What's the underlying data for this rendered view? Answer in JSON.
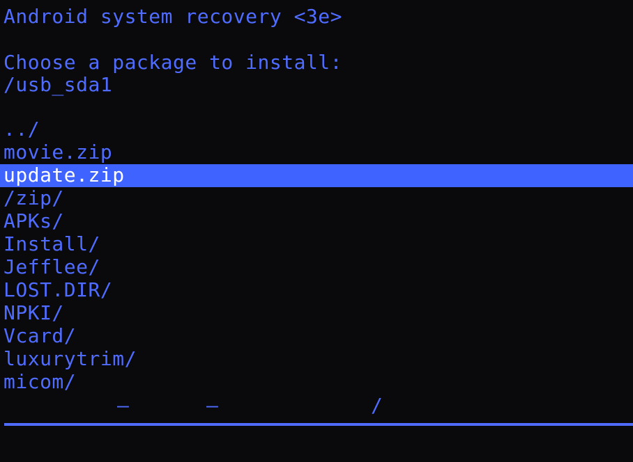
{
  "colors": {
    "background": "#0a0a0c",
    "text": "#4f6cff",
    "selection_background": "#3f63ff",
    "selection_text": "#ffffff"
  },
  "header": {
    "title": "Android system recovery <3e>"
  },
  "prompt": {
    "text": "Choose a package to install:",
    "path": "/usb_sda1"
  },
  "files": [
    {
      "name": "../",
      "selected": false
    },
    {
      "name": "movie.zip",
      "selected": false
    },
    {
      "name": "update.zip",
      "selected": true
    },
    {
      "name": "/zip/",
      "selected": false
    },
    {
      "name": "APKs/",
      "selected": false
    },
    {
      "name": "Install/",
      "selected": false
    },
    {
      "name": "Jefflee/",
      "selected": false
    },
    {
      "name": "LOST.DIR/",
      "selected": false
    },
    {
      "name": "NPKI/",
      "selected": false
    },
    {
      "name": "Vcard/",
      "selected": false
    },
    {
      "name": "luxurytrim/",
      "selected": false
    },
    {
      "name": "micom/",
      "selected": false
    }
  ],
  "status": {
    "glyphs": [
      "–",
      "–",
      "/"
    ]
  }
}
